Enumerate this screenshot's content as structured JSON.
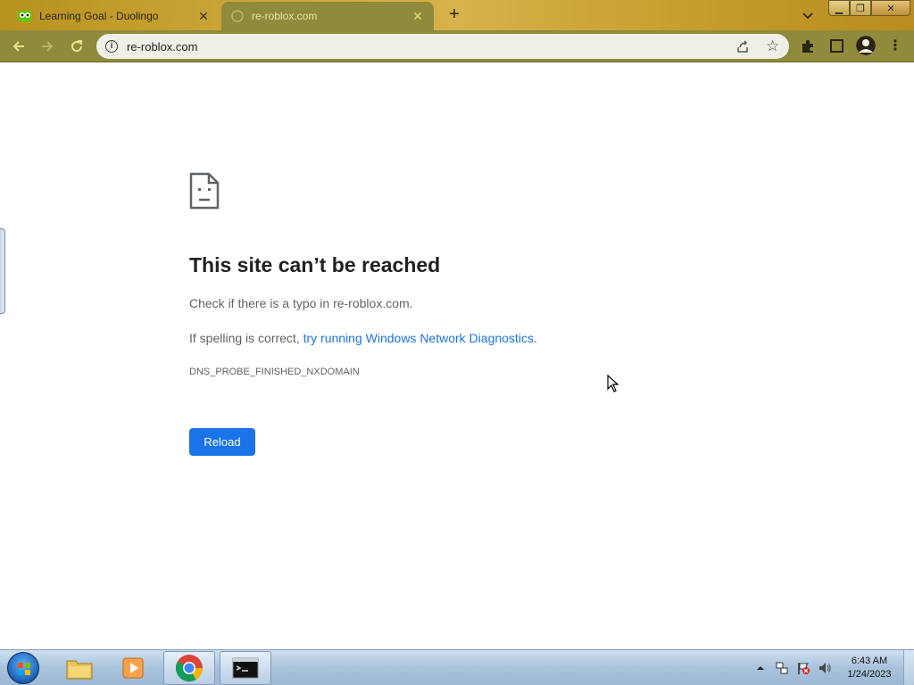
{
  "browser": {
    "tabs": [
      {
        "label": "Learning Goal - Duolingo",
        "favicon": "duolingo-owl-icon",
        "active": false
      },
      {
        "label": "re-roblox.com",
        "favicon": "globe-icon",
        "active": true
      }
    ],
    "address_bar": {
      "url": "re-roblox.com"
    },
    "window_controls": {
      "minimize": "▁",
      "maximize": "❐",
      "close": "✕"
    }
  },
  "page": {
    "icon": "sad-page-icon",
    "title": "This site can’t be reached",
    "line1": "Check if there is a typo in re-roblox.com.",
    "line2_prefix": "If spelling is correct, ",
    "line2_link": "try running Windows Network Diagnostics",
    "line2_suffix": ".",
    "error_code": "DNS_PROBE_FINISHED_NXDOMAIN",
    "reload_label": "Reload"
  },
  "taskbar": {
    "apps": [
      "file-explorer-icon",
      "media-player-icon",
      "chrome-icon",
      "cmd-icon"
    ],
    "clock": {
      "time": "6:43 AM",
      "date": "1/24/2023"
    }
  },
  "colors": {
    "link": "#1a73e8",
    "button": "#1a73e8",
    "toolbar": "#8f8a3c"
  }
}
